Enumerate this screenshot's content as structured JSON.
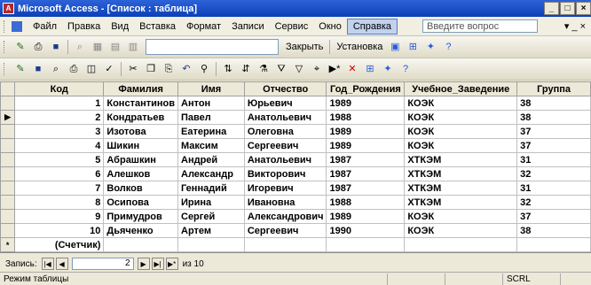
{
  "window": {
    "title": "Microsoft Access - [Список : таблица]"
  },
  "menu": [
    "Файл",
    "Правка",
    "Вид",
    "Вставка",
    "Формат",
    "Записи",
    "Сервис",
    "Окно",
    "Справка"
  ],
  "help_placeholder": "Введите вопрос",
  "toolbar1": {
    "close_label": "Закрыть",
    "install_label": "Установка"
  },
  "table": {
    "columns": [
      "Код",
      "Фамилия",
      "Имя",
      "Отчество",
      "Год_Рождения",
      "Учебное_Заведение",
      "Группа"
    ],
    "rows": [
      [
        "1",
        "Константинов",
        "Антон",
        "Юрьевич",
        "1989",
        "КОЭК",
        "38"
      ],
      [
        "2",
        "Кондратьев",
        "Павел",
        "Анатольевич",
        "1988",
        "КОЭК",
        "38"
      ],
      [
        "3",
        "Изотова",
        "Еатерина",
        "Олеговна",
        "1989",
        "КОЭК",
        "37"
      ],
      [
        "4",
        "Шикин",
        "Максим",
        "Сергеевич",
        "1989",
        "КОЭК",
        "37"
      ],
      [
        "5",
        "Абрашкин",
        "Андрей",
        "Анатольевич",
        "1987",
        "ХТКЭМ",
        "31"
      ],
      [
        "6",
        "Алешков",
        "Александр",
        "Викторович",
        "1987",
        "ХТКЭМ",
        "32"
      ],
      [
        "7",
        "Волков",
        "Геннадий",
        "Игоревич",
        "1987",
        "ХТКЭМ",
        "31"
      ],
      [
        "8",
        "Осипова",
        "Ирина",
        "Ивановна",
        "1988",
        "ХТКЭМ",
        "32"
      ],
      [
        "9",
        "Примудров",
        "Сергей",
        "Александрович",
        "1989",
        "КОЭК",
        "37"
      ],
      [
        "10",
        "Дьяченко",
        "Артем",
        "Сергеевич",
        "1990",
        "КОЭК",
        "38"
      ]
    ],
    "new_row_label": "(Счетчик)",
    "current_row_marker": "▶",
    "new_row_marker": "*"
  },
  "nav": {
    "record_label": "Запись:",
    "current": "2",
    "of_label": "из 10"
  },
  "status": {
    "mode": "Режим таблицы",
    "scrl": "SCRL"
  }
}
